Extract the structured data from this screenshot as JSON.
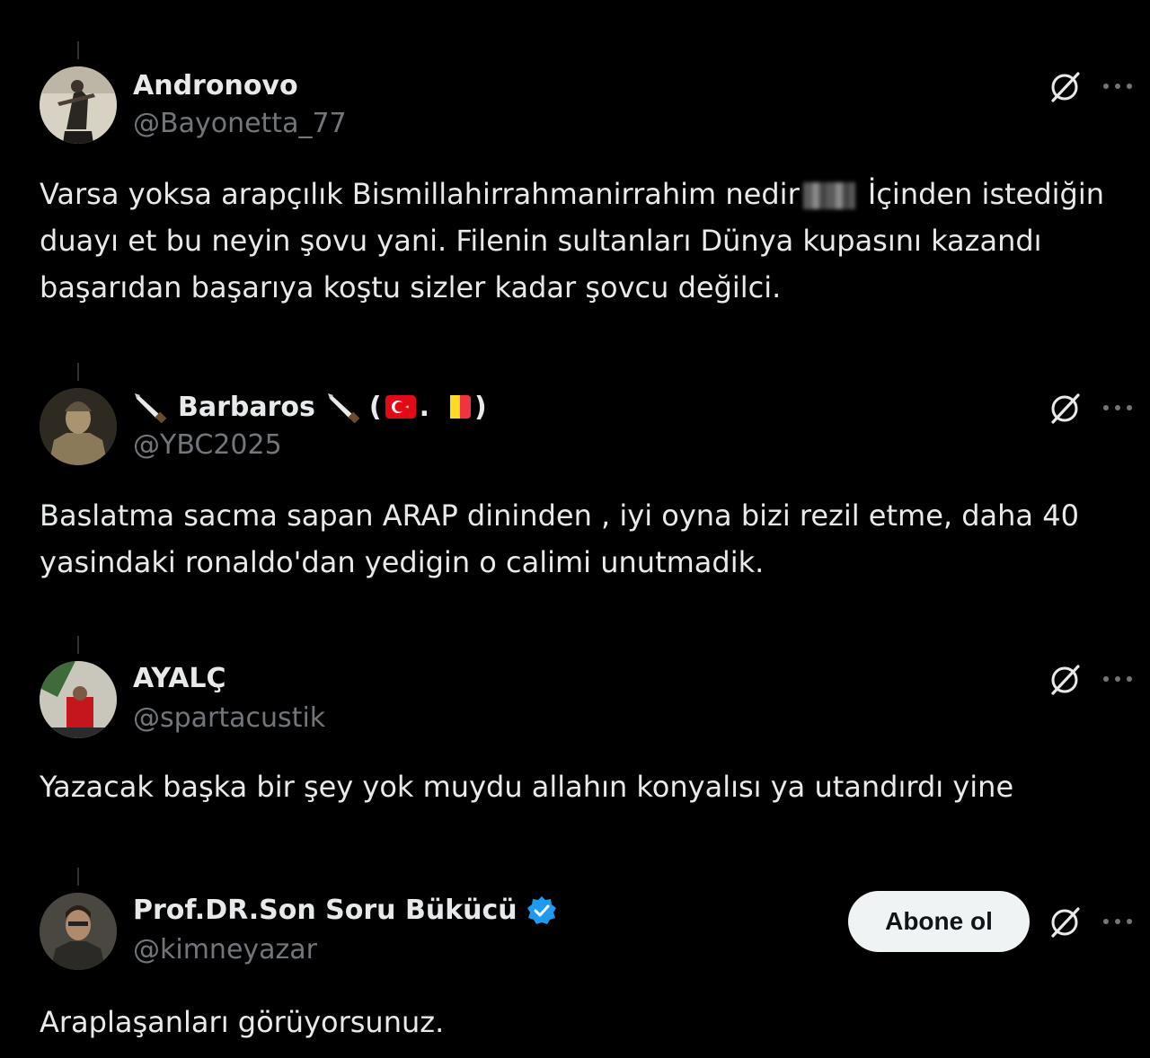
{
  "tweets": [
    {
      "display_name": "Andronovo",
      "handle": "@Bayonetta_77",
      "text_part1": "Varsa yoksa arapçılık Bismillahirrahmanirrahim nedir",
      "text_part2": " İçinden istediğin duayı et bu neyin şovu yani. Filenin sultanları Dünya kupasını kazandı başarıdan başarıya koştu sizler kadar şovcu değilci."
    },
    {
      "display_name": "Barbaros",
      "name_paren_open": "(",
      "name_dot": ".",
      "name_paren_close": ")",
      "handle": "@YBC2025",
      "text": "Baslatma sacma sapan ARAP dininden , iyi oyna bizi rezil etme, daha 40 yasindaki ronaldo'dan yedigin o calimi unutmadik."
    },
    {
      "display_name": "AYALÇ",
      "handle": "@spartacustik",
      "text": "Yazacak başka bir şey yok muydu allahın konyalısı ya utandırdı yine"
    },
    {
      "display_name": "Prof.DR.Son Soru Bükücü",
      "handle": "@kimneyazar",
      "subscribe_label": "Abone ol",
      "text": "Araplaşanları görüyorsunuz."
    }
  ],
  "icons": {
    "grok": "grok-icon",
    "more": "more-options-icon",
    "verified": "verified-badge-icon",
    "knife": "knife-emoji-icon",
    "flag_turkey": "turkey-flag-icon",
    "flag_belgium": "belgium-flag-icon"
  },
  "colors": {
    "background": "#000000",
    "text_primary": "#e7e9ea",
    "text_secondary": "#71767b",
    "verified_blue": "#1d9bf0",
    "button_bg": "#eff3f4"
  }
}
